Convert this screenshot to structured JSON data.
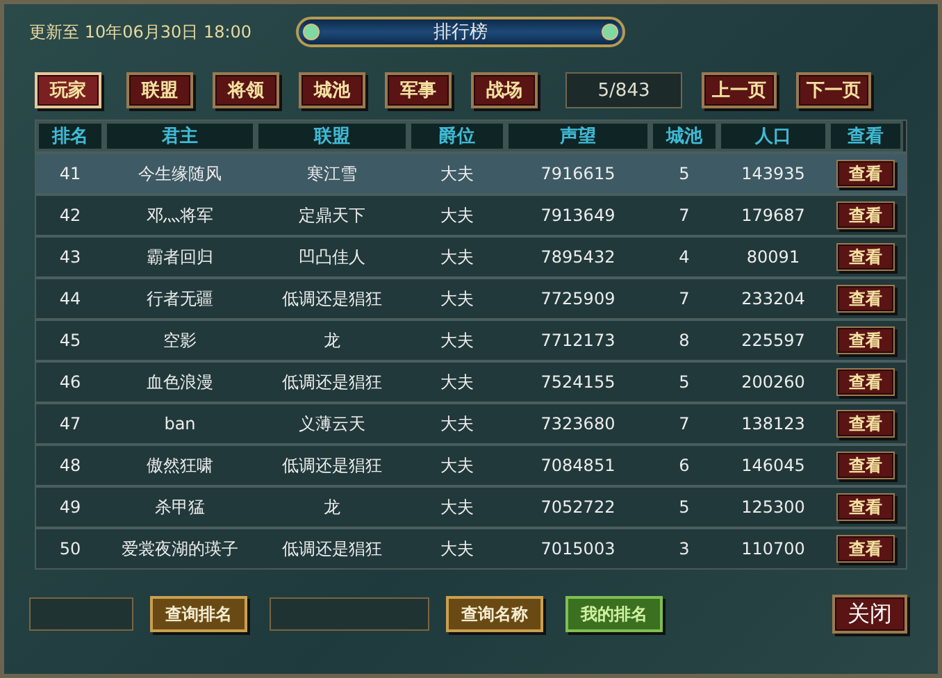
{
  "window": {
    "title": "排行榜"
  },
  "updated": "更新至 10年06月30日 18:00",
  "tabs": [
    {
      "label": "玩家",
      "selected": true
    },
    {
      "label": "联盟",
      "selected": false
    },
    {
      "label": "将领",
      "selected": false
    },
    {
      "label": "城池",
      "selected": false
    },
    {
      "label": "军事",
      "selected": false
    },
    {
      "label": "战场",
      "selected": false
    }
  ],
  "page": "5/843",
  "pager": [
    "上一页",
    "下一页"
  ],
  "table": {
    "columns": [
      "排名",
      "君主",
      "联盟",
      "爵位",
      "声望",
      "城池",
      "人口",
      "查看"
    ],
    "rows": [
      {
        "selected": true,
        "cells": [
          "41",
          "今生缘随风",
          "寒江雪",
          "大夫",
          "7916615",
          "5",
          "143935"
        ],
        "action": "查看"
      },
      {
        "selected": false,
        "cells": [
          "42",
          "邓灬将军",
          "定鼎天下",
          "大夫",
          "7913649",
          "7",
          "179687"
        ],
        "action": "查看"
      },
      {
        "selected": false,
        "cells": [
          "43",
          "霸者回归",
          "凹凸佳人",
          "大夫",
          "7895432",
          "4",
          "80091"
        ],
        "action": "查看"
      },
      {
        "selected": false,
        "cells": [
          "44",
          "行者无疆",
          "低调还是猖狂",
          "大夫",
          "7725909",
          "7",
          "233204"
        ],
        "action": "查看"
      },
      {
        "selected": false,
        "cells": [
          "45",
          "空影",
          "龙",
          "大夫",
          "7712173",
          "8",
          "225597"
        ],
        "action": "查看"
      },
      {
        "selected": false,
        "cells": [
          "46",
          "血色浪漫",
          "低调还是猖狂",
          "大夫",
          "7524155",
          "5",
          "200260"
        ],
        "action": "查看"
      },
      {
        "selected": false,
        "cells": [
          "47",
          "ban",
          "义薄云天",
          "大夫",
          "7323680",
          "7",
          "138123"
        ],
        "action": "查看"
      },
      {
        "selected": false,
        "cells": [
          "48",
          "傲然狂啸",
          "低调还是猖狂",
          "大夫",
          "7084851",
          "6",
          "146045"
        ],
        "action": "查看"
      },
      {
        "selected": false,
        "cells": [
          "49",
          "杀甲猛",
          "龙",
          "大夫",
          "7052722",
          "5",
          "125300"
        ],
        "action": "查看"
      },
      {
        "selected": false,
        "cells": [
          "50",
          "爱裳夜湖的瑛子",
          "低调还是猖狂",
          "大夫",
          "7015003",
          "3",
          "110700"
        ],
        "action": "查看"
      }
    ]
  },
  "footer": [
    {
      "kind": "field"
    },
    {
      "kind": "gold",
      "label": "查询排名"
    },
    {
      "kind": "field"
    },
    {
      "kind": "gold",
      "label": "查询名称"
    },
    {
      "kind": "green",
      "label": "我的排名"
    },
    {
      "kind": "red",
      "label": "关闭"
    }
  ]
}
